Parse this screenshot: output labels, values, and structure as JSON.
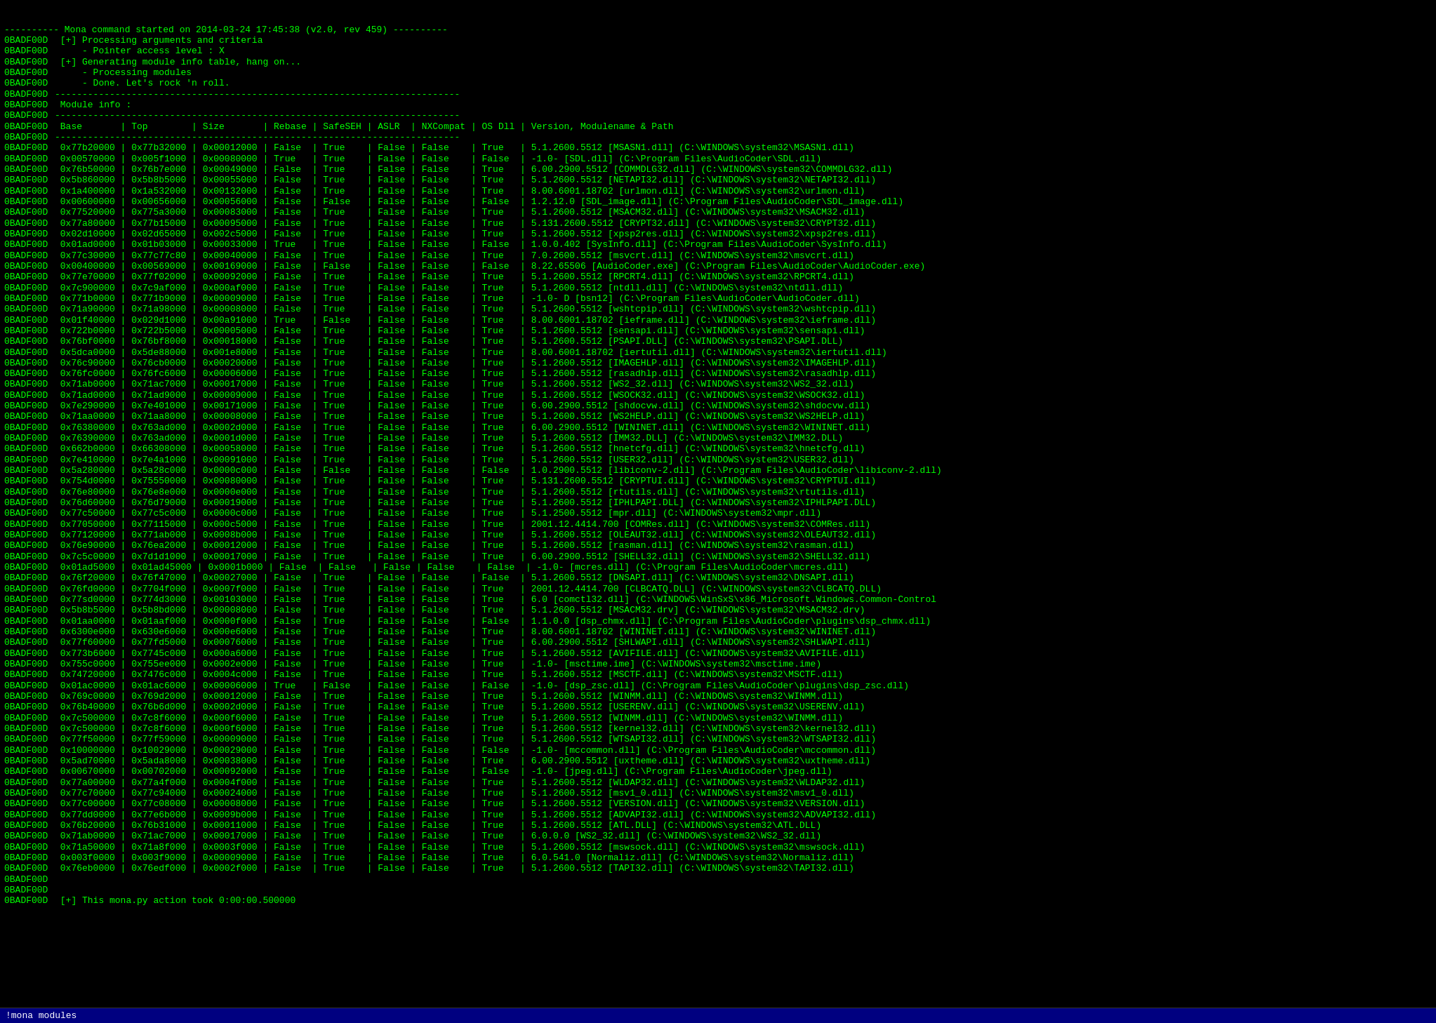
{
  "terminal": {
    "title": "!mona modules",
    "statusBar": "!mona modules",
    "lines": [
      {
        "addr": "",
        "content": "---------- Mona command started on 2014-03-24 17:45:38 (v2.0, rev 459) ----------"
      },
      {
        "addr": "0BADF00D",
        "content": " [+] Processing arguments and criteria"
      },
      {
        "addr": "0BADF00D",
        "content": "     - Pointer access level : X"
      },
      {
        "addr": "0BADF00D",
        "content": " [+] Generating module info table, hang on..."
      },
      {
        "addr": "0BADF00D",
        "content": "     - Processing modules"
      },
      {
        "addr": "0BADF00D",
        "content": "     - Done. Let's rock 'n roll."
      },
      {
        "addr": "0BADF00D",
        "content": "--------------------------------------------------------------------------"
      },
      {
        "addr": "0BADF00D",
        "content": " Module info :"
      },
      {
        "addr": "0BADF00D",
        "content": "--------------------------------------------------------------------------"
      },
      {
        "addr": "0BADF00D",
        "content": " Base       | Top        | Size       | Rebase | SafeSEH | ASLR  | NXCompat | OS Dll | Version, Modulename & Path"
      },
      {
        "addr": "0BADF00D",
        "content": "--------------------------------------------------------------------------"
      },
      {
        "addr": "0BADF00D",
        "content": " 0x77b20000 | 0x77b32000 | 0x00012000 | False  | True    | False | False    | True   | 5.1.2600.5512 [MSASN1.dll] (C:\\WINDOWS\\system32\\MSASN1.dll)"
      },
      {
        "addr": "0BADF00D",
        "content": " 0x00570000 | 0x005f1000 | 0x00080000 | True   | True    | False | False    | False  | -1.0- [SDL.dll] (C:\\Program Files\\AudioCoder\\SDL.dll)"
      },
      {
        "addr": "0BADF00D",
        "content": " 0x76b50000 | 0x76b7e000 | 0x00049000 | False  | True    | False | False    | True   | 6.00.2900.5512 [COMMDLG32.dll] (C:\\WINDOWS\\system32\\COMMDLG32.dll)"
      },
      {
        "addr": "0BADF00D",
        "content": " 0x5b860000 | 0x5b8b5000 | 0x00055000 | False  | True    | False | False    | True   | 5.1.2600.5512 [NETAPI32.dll] (C:\\WINDOWS\\system32\\NETAPI32.dll)"
      },
      {
        "addr": "0BADF00D",
        "content": " 0x1a400000 | 0x1a532000 | 0x00132000 | False  | True    | False | False    | True   | 8.00.6001.18702 [urlmon.dll] (C:\\WINDOWS\\system32\\urlmon.dll)"
      },
      {
        "addr": "0BADF00D",
        "content": " 0x00600000 | 0x00656000 | 0x00056000 | False  | False   | False | False    | False  | 1.2.12.0 [SDL_image.dll] (C:\\Program Files\\AudioCoder\\SDL_image.dll)"
      },
      {
        "addr": "0BADF00D",
        "content": " 0x77520000 | 0x775a3000 | 0x00083000 | False  | True    | False | False    | True   | 5.1.2600.5512 [MSACM32.dll] (C:\\WINDOWS\\system32\\MSACM32.dll)"
      },
      {
        "addr": "0BADF00D",
        "content": " 0x77a80000 | 0x77b15000 | 0x00095000 | False  | True    | False | False    | True   | 5.131.2600.5512 [CRYPT32.dll] (C:\\WINDOWS\\system32\\CRYPT32.dll)"
      },
      {
        "addr": "0BADF00D",
        "content": " 0x02d10000 | 0x02d65000 | 0x002c5000 | False  | True    | False | False    | True   | 5.1.2600.5512 [xpsp2res.dll] (C:\\WINDOWS\\system32\\xpsp2res.dll)"
      },
      {
        "addr": "0BADF00D",
        "content": " 0x01ad0000 | 0x01b03000 | 0x00033000 | True   | True    | False | False    | False  | 1.0.0.402 [SysInfo.dll] (C:\\Program Files\\AudioCoder\\SysInfo.dll)"
      },
      {
        "addr": "0BADF00D",
        "content": " 0x77c30000 | 0x77c77c80 | 0x00040000 | False  | True    | False | False    | True   | 7.0.2600.5512 [msvcrt.dll] (C:\\WINDOWS\\system32\\msvcrt.dll)"
      },
      {
        "addr": "0BADF00D",
        "content": " 0x00400000 | 0x00569000 | 0x00169000 | False  | False   | False | False    | False  | 8.22.65506 [AudioCoder.exe] (C:\\Program Files\\AudioCoder\\AudioCoder.exe)"
      },
      {
        "addr": "0BADF00D",
        "content": " 0x77e70000 | 0x77f02000 | 0x00092000 | False  | True    | False | False    | True   | 5.1.2600.5512 [RPCRT4.dll] (C:\\WINDOWS\\system32\\RPCRT4.dll)"
      },
      {
        "addr": "0BADF00D",
        "content": " 0x7c900000 | 0x7c9af000 | 0x000af000 | False  | True    | False | False    | True   | 5.1.2600.5512 [ntdll.dll] (C:\\WINDOWS\\system32\\ntdll.dll)"
      },
      {
        "addr": "0BADF00D",
        "content": " 0x771b0000 | 0x771b9000 | 0x00009000 | False  | True    | False | False    | True   | -1.0- D [bsn12] (C:\\Program Files\\AudioCoder\\AudioCoder.dll)"
      },
      {
        "addr": "0BADF00D",
        "content": " 0x71a90000 | 0x71a98000 | 0x00008000 | False  | True    | False | False    | True   | 5.1.2600.5512 [wshtcpip.dll] (C:\\WINDOWS\\system32\\wshtcpip.dll)"
      },
      {
        "addr": "0BADF00D",
        "content": " 0x01f40000 | 0x029d1000 | 0x00a91000 | True   | False   | False | False    | True   | 8.00.6001.18702 [ieframe.dll] (C:\\WINDOWS\\system32\\ieframe.dll)"
      },
      {
        "addr": "0BADF00D",
        "content": " 0x722b0000 | 0x722b5000 | 0x00005000 | False  | True    | False | False    | True   | 5.1.2600.5512 [sensapi.dll] (C:\\WINDOWS\\system32\\sensapi.dll)"
      },
      {
        "addr": "0BADF00D",
        "content": " 0x76bf0000 | 0x76bf8000 | 0x00018000 | False  | True    | False | False    | True   | 5.1.2600.5512 [PSAPI.DLL] (C:\\WINDOWS\\system32\\PSAPI.DLL)"
      },
      {
        "addr": "0BADF00D",
        "content": " 0x5dca0000 | 0x5de88000 | 0x001e8000 | False  | True    | False | False    | True   | 8.00.6001.18702 [iertutil.dll] (C:\\WINDOWS\\system32\\iertutil.dll)"
      },
      {
        "addr": "0BADF00D",
        "content": " 0x76c90000 | 0x76cb0000 | 0x00020000 | False  | True    | False | False    | True   | 5.1.2600.5512 [IMAGEHLP.dll] (C:\\WINDOWS\\system32\\IMAGEHLP.dll)"
      },
      {
        "addr": "0BADF00D",
        "content": " 0x76fc0000 | 0x76fc6000 | 0x00006000 | False  | True    | False | False    | True   | 5.1.2600.5512 [rasadhlp.dll] (C:\\WINDOWS\\system32\\rasadhlp.dll)"
      },
      {
        "addr": "0BADF00D",
        "content": " 0x71ab0000 | 0x71ac7000 | 0x00017000 | False  | True    | False | False    | True   | 5.1.2600.5512 [WS2_32.dll] (C:\\WINDOWS\\system32\\WS2_32.dll)"
      },
      {
        "addr": "0BADF00D",
        "content": " 0x71ad0000 | 0x71ad9000 | 0x00009000 | False  | True    | False | False    | True   | 5.1.2600.5512 [WSOCK32.dll] (C:\\WINDOWS\\system32\\WSOCK32.dll)"
      },
      {
        "addr": "0BADF00D",
        "content": " 0x7e290000 | 0x7e401000 | 0x00171000 | False  | True    | False | False    | True   | 6.00.2900.5512 [shdocvw.dll] (C:\\WINDOWS\\system32\\shdocvw.dll)"
      },
      {
        "addr": "0BADF00D",
        "content": " 0x71aa0000 | 0x71aa8000 | 0x00008000 | False  | True    | False | False    | True   | 5.1.2600.5512 [WS2HELP.dll] (C:\\WINDOWS\\system32\\WS2HELP.dll)"
      },
      {
        "addr": "0BADF00D",
        "content": " 0x76380000 | 0x763ad000 | 0x0002d000 | False  | True    | False | False    | True   | 6.00.2900.5512 [WININET.dll] (C:\\WINDOWS\\system32\\WININET.dll)"
      },
      {
        "addr": "0BADF00D",
        "content": " 0x76390000 | 0x763ad000 | 0x0001d000 | False  | True    | False | False    | True   | 5.1.2600.5512 [IMM32.DLL] (C:\\WINDOWS\\system32\\IMM32.DLL)"
      },
      {
        "addr": "0BADF00D",
        "content": " 0x662b0000 | 0x66308000 | 0x00058000 | False  | True    | False | False    | True   | 5.1.2600.5512 [hnetcfg.dll] (C:\\WINDOWS\\system32\\hnetcfg.dll)"
      },
      {
        "addr": "0BADF00D",
        "content": " 0x7e410000 | 0x7e4a1000 | 0x00091000 | False  | True    | False | False    | True   | 5.1.2600.5512 [USER32.dll] (C:\\WINDOWS\\system32\\USER32.dll)"
      },
      {
        "addr": "0BADF00D",
        "content": " 0x5a280000 | 0x5a28c000 | 0x0000c000 | False  | False   | False | False    | False  | 1.0.2900.5512 [libiconv-2.dll] (C:\\Program Files\\AudioCoder\\libiconv-2.dll)"
      },
      {
        "addr": "0BADF00D",
        "content": " 0x754d0000 | 0x75550000 | 0x00080000 | False  | True    | False | False    | True   | 5.131.2600.5512 [CRYPTUI.dll] (C:\\WINDOWS\\system32\\CRYPTUI.dll)"
      },
      {
        "addr": "0BADF00D",
        "content": " 0x76e80000 | 0x76e8e000 | 0x0000e000 | False  | True    | False | False    | True   | 5.1.2600.5512 [rtutils.dll] (C:\\WINDOWS\\system32\\rtutils.dll)"
      },
      {
        "addr": "0BADF00D",
        "content": " 0x76d60000 | 0x76d79000 | 0x00019000 | False  | True    | False | False    | True   | 5.1.2600.5512 [IPHLPAPI.DLL] (C:\\WINDOWS\\system32\\IPHLPAPI.DLL)"
      },
      {
        "addr": "0BADF00D",
        "content": " 0x77c50000 | 0x77c5c000 | 0x0000c000 | False  | True    | False | False    | True   | 5.1.2500.5512 [mpr.dll] (C:\\WINDOWS\\system32\\mpr.dll)"
      },
      {
        "addr": "0BADF00D",
        "content": " 0x77050000 | 0x77115000 | 0x000c5000 | False  | True    | False | False    | True   | 2001.12.4414.700 [COMRes.dll] (C:\\WINDOWS\\system32\\COMRes.dll)"
      },
      {
        "addr": "0BADF00D",
        "content": " 0x77120000 | 0x771ab000 | 0x0008b000 | False  | True    | False | False    | True   | 5.1.2600.5512 [OLEAUT32.dll] (C:\\WINDOWS\\system32\\OLEAUT32.dll)"
      },
      {
        "addr": "0BADF00D",
        "content": " 0x76e90000 | 0x76ea2000 | 0x00012000 | False  | True    | False | False    | True   | 5.1.2600.5512 [rasman.dll] (C:\\WINDOWS\\system32\\rasman.dll)"
      },
      {
        "addr": "0BADF00D",
        "content": " 0x7c5c0000 | 0x7d1d1000 | 0x00017000 | False  | True    | False | False    | True   | 6.00.2900.5512 [SHELL32.dll] (C:\\WINDOWS\\system32\\SHELL32.dll)"
      },
      {
        "addr": "0BADF00D",
        "content": " 0x01ad5000 | 0x01ad45000 | 0x0001b000 | False  | False   | False | False    | False  | -1.0- [mcres.dll] (C:\\Program Files\\AudioCoder\\mcres.dll)"
      },
      {
        "addr": "0BADF00D",
        "content": " 0x76f20000 | 0x76f47000 | 0x00027000 | False  | True    | False | False    | False  | 5.1.2600.5512 [DNSAPI.dll] (C:\\WINDOWS\\system32\\DNSAPI.dll)"
      },
      {
        "addr": "0BADF00D",
        "content": " 0x76fd0000 | 0x7704f000 | 0x0007f000 | False  | True    | False | False    | True   | 2001.12.4414.700 [CLBCATQ.DLL] (C:\\WINDOWS\\system32\\CLBCATQ.DLL)"
      },
      {
        "addr": "0BADF00D",
        "content": " 0x77sd0000 | 0x774d3000 | 0x00103000 | False  | True    | False | False    | True   | 6.0 [comctl32.dll] (C:\\WINDOWS\\WinSxS\\x86_Microsoft.Windows.Common-Control"
      },
      {
        "addr": "0BADF00D",
        "content": " 0x5b8b5000 | 0x5b8bd000 | 0x00008000 | False  | True    | False | False    | True   | 5.1.2600.5512 [MSACM32.drv] (C:\\WINDOWS\\system32\\MSACM32.drv)"
      },
      {
        "addr": "0BADF00D",
        "content": " 0x01aa0000 | 0x01aaf000 | 0x0000f000 | False  | True    | False | False    | False  | 1.1.0.0 [dsp_chmx.dll] (C:\\Program Files\\AudioCoder\\plugins\\dsp_chmx.dll)"
      },
      {
        "addr": "0BADF00D",
        "content": " 0x6300e000 | 0x630e6000 | 0x000e6000 | False  | True    | False | False    | True   | 8.00.6001.18702 [WININET.dll] (C:\\WINDOWS\\system32\\WININET.dll)"
      },
      {
        "addr": "0BADF00D",
        "content": " 0x77f60000 | 0x77fd5000 | 0x00076000 | False  | True    | False | False    | True   | 6.00.2900.5512 [SHLWAPI.dll] (C:\\WINDOWS\\system32\\SHLWAPI.dll)"
      },
      {
        "addr": "0BADF00D",
        "content": " 0x773b6000 | 0x7745c000 | 0x000a6000 | False  | True    | False | False    | True   | 5.1.2600.5512 [AVIFILE.dll] (C:\\WINDOWS\\system32\\AVIFILE.dll)"
      },
      {
        "addr": "0BADF00D",
        "content": " 0x755c0000 | 0x755ee000 | 0x0002e000 | False  | True    | False | False    | True   | -1.0- [msctime.ime] (C:\\WINDOWS\\system32\\msctime.ime)"
      },
      {
        "addr": "0BADF00D",
        "content": " 0x74720000 | 0x7476c000 | 0x0004c000 | False  | True    | False | False    | True   | 5.1.2600.5512 [MSCTF.dll] (C:\\WINDOWS\\system32\\MSCTF.dll)"
      },
      {
        "addr": "0BADF00D",
        "content": " 0x01ac0000 | 0x01ac6000 | 0x00006000 | True   | False   | False | False    | False  | -1.0- [dsp_zsc.dll] (C:\\Program Files\\AudioCoder\\plugins\\dsp_zsc.dll)"
      },
      {
        "addr": "0BADF00D",
        "content": " 0x769c0000 | 0x769d2000 | 0x00012000 | False  | True    | False | False    | True   | 5.1.2600.5512 [WINMM.dll] (C:\\WINDOWS\\system32\\WINMM.dll)"
      },
      {
        "addr": "0BADF00D",
        "content": " 0x76b40000 | 0x76b6d000 | 0x0002d000 | False  | True    | False | False    | True   | 5.1.2600.5512 [USERENV.dll] (C:\\WINDOWS\\system32\\USERENV.dll)"
      },
      {
        "addr": "0BADF00D",
        "content": " 0x7c500000 | 0x7c8f6000 | 0x000f6000 | False  | True    | False | False    | True   | 5.1.2600.5512 [WINMM.dll] (C:\\WINDOWS\\system32\\WINMM.dll)"
      },
      {
        "addr": "0BADF00D",
        "content": " 0x7c500000 | 0x7c8f6000 | 0x000f6000 | False  | True    | False | False    | True   | 5.1.2600.5512 [kernel32.dll] (C:\\WINDOWS\\system32\\kernel32.dll)"
      },
      {
        "addr": "0BADF00D",
        "content": " 0x77f50000 | 0x77f59000 | 0x00009000 | False  | True    | False | False    | True   | 5.1.2600.5512 [WTSAPI32.dll] (C:\\WINDOWS\\system32\\WTSAPI32.dll)"
      },
      {
        "addr": "0BADF00D",
        "content": " 0x10000000 | 0x10029000 | 0x00029000 | False  | True    | False | False    | False  | -1.0- [mccommon.dll] (C:\\Program Files\\AudioCoder\\mccommon.dll)"
      },
      {
        "addr": "0BADF00D",
        "content": " 0x5ad70000 | 0x5ada8000 | 0x00038000 | False  | True    | False | False    | True   | 6.00.2900.5512 [uxtheme.dll] (C:\\WINDOWS\\system32\\uxtheme.dll)"
      },
      {
        "addr": "0BADF00D",
        "content": " 0x00670000 | 0x00702000 | 0x00092000 | False  | True    | False | False    | False  | -1.0- [jpeg.dll] (C:\\Program Files\\AudioCoder\\jpeg.dll)"
      },
      {
        "addr": "0BADF00D",
        "content": " 0x77a00000 | 0x77a4f000 | 0x0004f000 | False  | True    | False | False    | True   | 5.1.2600.5512 [WLDAP32.dll] (C:\\WINDOWS\\system32\\WLDAP32.dll)"
      },
      {
        "addr": "0BADF00D",
        "content": " 0x77c70000 | 0x77c94000 | 0x00024000 | False  | True    | False | False    | True   | 5.1.2600.5512 [msv1_0.dll] (C:\\WINDOWS\\system32\\msv1_0.dll)"
      },
      {
        "addr": "0BADF00D",
        "content": " 0x77c00000 | 0x77c08000 | 0x00008000 | False  | True    | False | False    | True   | 5.1.2600.5512 [VERSION.dll] (C:\\WINDOWS\\system32\\VERSION.dll)"
      },
      {
        "addr": "0BADF00D",
        "content": " 0x77dd0000 | 0x77e6b000 | 0x0009b000 | False  | True    | False | False    | True   | 5.1.2600.5512 [ADVAPI32.dll] (C:\\WINDOWS\\system32\\ADVAPI32.dll)"
      },
      {
        "addr": "0BADF00D",
        "content": " 0x76b20000 | 0x76b31000 | 0x00011000 | False  | True    | False | False    | True   | 5.1.2600.5512 [ATL.DLL] (C:\\WINDOWS\\system32\\ATL.DLL)"
      },
      {
        "addr": "0BADF00D",
        "content": " 0x71ab0000 | 0x71ac7000 | 0x00017000 | False  | True    | False | False    | True   | 6.0.0.0 [WS2_32.dll] (C:\\WINDOWS\\system32\\WS2_32.dll)"
      },
      {
        "addr": "0BADF00D",
        "content": " 0x71a50000 | 0x71a8f000 | 0x0003f000 | False  | True    | False | False    | True   | 5.1.2600.5512 [mswsock.dll] (C:\\WINDOWS\\system32\\mswsock.dll)"
      },
      {
        "addr": "0BADF00D",
        "content": " 0x003f0000 | 0x003f9000 | 0x00009000 | False  | True    | False | False    | True   | 6.0.541.0 [Normaliz.dll] (C:\\WINDOWS\\system32\\Normaliz.dll)"
      },
      {
        "addr": "0BADF00D",
        "content": " 0x76eb0000 | 0x76edf000 | 0x0002f000 | False  | True    | False | False    | True   | 5.1.2600.5512 [TAPI32.dll] (C:\\WINDOWS\\system32\\TAPI32.dll)"
      },
      {
        "addr": "0BADF00D",
        "content": ""
      },
      {
        "addr": "0BADF00D",
        "content": ""
      },
      {
        "addr": "0BADF00D",
        "content": " [+] This mona.py action took 0:00:00.500000"
      }
    ]
  }
}
